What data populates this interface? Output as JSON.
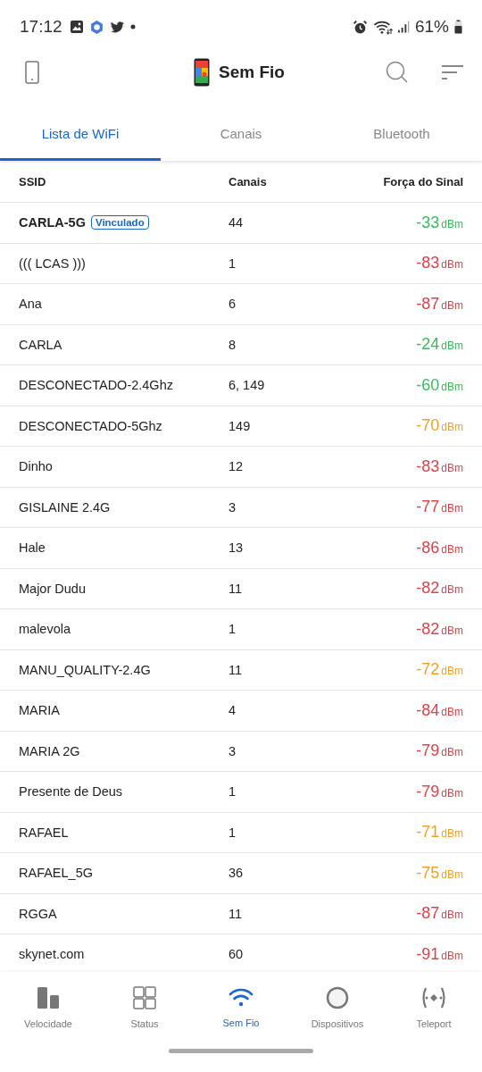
{
  "status_bar": {
    "time": "17:12",
    "battery": "61%"
  },
  "app_bar": {
    "title": "Sem Fio"
  },
  "tabs": [
    {
      "label": "Lista de WiFi",
      "selected": true
    },
    {
      "label": "Canais",
      "selected": false
    },
    {
      "label": "Bluetooth",
      "selected": false
    }
  ],
  "table": {
    "columns": [
      "SSID",
      "Canais",
      "Força do Sinal"
    ],
    "rows": [
      {
        "ssid": "CARLA-5G",
        "connected": true,
        "badge": "Vinculado",
        "channels": "44",
        "signal": "-33",
        "unit": "dBm",
        "color": "#3cb85e"
      },
      {
        "ssid": "((( LCAS )))",
        "connected": false,
        "channels": "1",
        "signal": "-83",
        "unit": "dBm",
        "color": "#d9434a"
      },
      {
        "ssid": "Ana",
        "connected": false,
        "channels": "6",
        "signal": "-87",
        "unit": "dBm",
        "color": "#d9434a"
      },
      {
        "ssid": "CARLA",
        "connected": false,
        "channels": "8",
        "signal": "-24",
        "unit": "dBm",
        "color": "#3cb85e"
      },
      {
        "ssid": "DESCONECTADO-2.4Ghz",
        "connected": false,
        "channels": "6, 149",
        "signal": "-60",
        "unit": "dBm",
        "color": "#3cb85e"
      },
      {
        "ssid": "DESCONECTADO-5Ghz",
        "connected": false,
        "channels": "149",
        "signal": "-70",
        "unit": "dBm",
        "color": "#f0a028"
      },
      {
        "ssid": "Dinho",
        "connected": false,
        "channels": "12",
        "signal": "-83",
        "unit": "dBm",
        "color": "#d9434a"
      },
      {
        "ssid": "GISLAINE 2.4G",
        "connected": false,
        "channels": "3",
        "signal": "-77",
        "unit": "dBm",
        "color": "#d9434a"
      },
      {
        "ssid": "Hale",
        "connected": false,
        "channels": "13",
        "signal": "-86",
        "unit": "dBm",
        "color": "#d9434a"
      },
      {
        "ssid": "Major Dudu",
        "connected": false,
        "channels": "11",
        "signal": "-82",
        "unit": "dBm",
        "color": "#d9434a"
      },
      {
        "ssid": "malevola",
        "connected": false,
        "channels": "1",
        "signal": "-82",
        "unit": "dBm",
        "color": "#d9434a"
      },
      {
        "ssid": "MANU_QUALITY-2.4G",
        "connected": false,
        "channels": "11",
        "signal": "-72",
        "unit": "dBm",
        "color": "#f0a028"
      },
      {
        "ssid": "MARIA",
        "connected": false,
        "channels": "4",
        "signal": "-84",
        "unit": "dBm",
        "color": "#d9434a"
      },
      {
        "ssid": "MARIA 2G",
        "connected": false,
        "channels": "3",
        "signal": "-79",
        "unit": "dBm",
        "color": "#d9434a"
      },
      {
        "ssid": "Presente de Deus",
        "connected": false,
        "channels": "1",
        "signal": "-79",
        "unit": "dBm",
        "color": "#d9434a"
      },
      {
        "ssid": "RAFAEL",
        "connected": false,
        "channels": "1",
        "signal": "-71",
        "unit": "dBm",
        "color": "#f0a028"
      },
      {
        "ssid": "RAFAEL_5G",
        "connected": false,
        "channels": "36",
        "signal": "-75",
        "unit": "dBm",
        "color": "#f0a028"
      },
      {
        "ssid": "RGGA",
        "connected": false,
        "channels": "11",
        "signal": "-87",
        "unit": "dBm",
        "color": "#d9434a"
      },
      {
        "ssid": "skynet.com",
        "connected": false,
        "channels": "60",
        "signal": "-91",
        "unit": "dBm",
        "color": "#d9434a"
      }
    ]
  },
  "bottom_nav": [
    {
      "label": "Velocidade",
      "kind": "speed",
      "selected": false
    },
    {
      "label": "Status",
      "kind": "status",
      "selected": false
    },
    {
      "label": "Sem Fio",
      "kind": "wireless",
      "selected": true
    },
    {
      "label": "Dispositivos",
      "kind": "devices",
      "selected": false
    },
    {
      "label": "Teleport",
      "kind": "teleport",
      "selected": false
    }
  ]
}
